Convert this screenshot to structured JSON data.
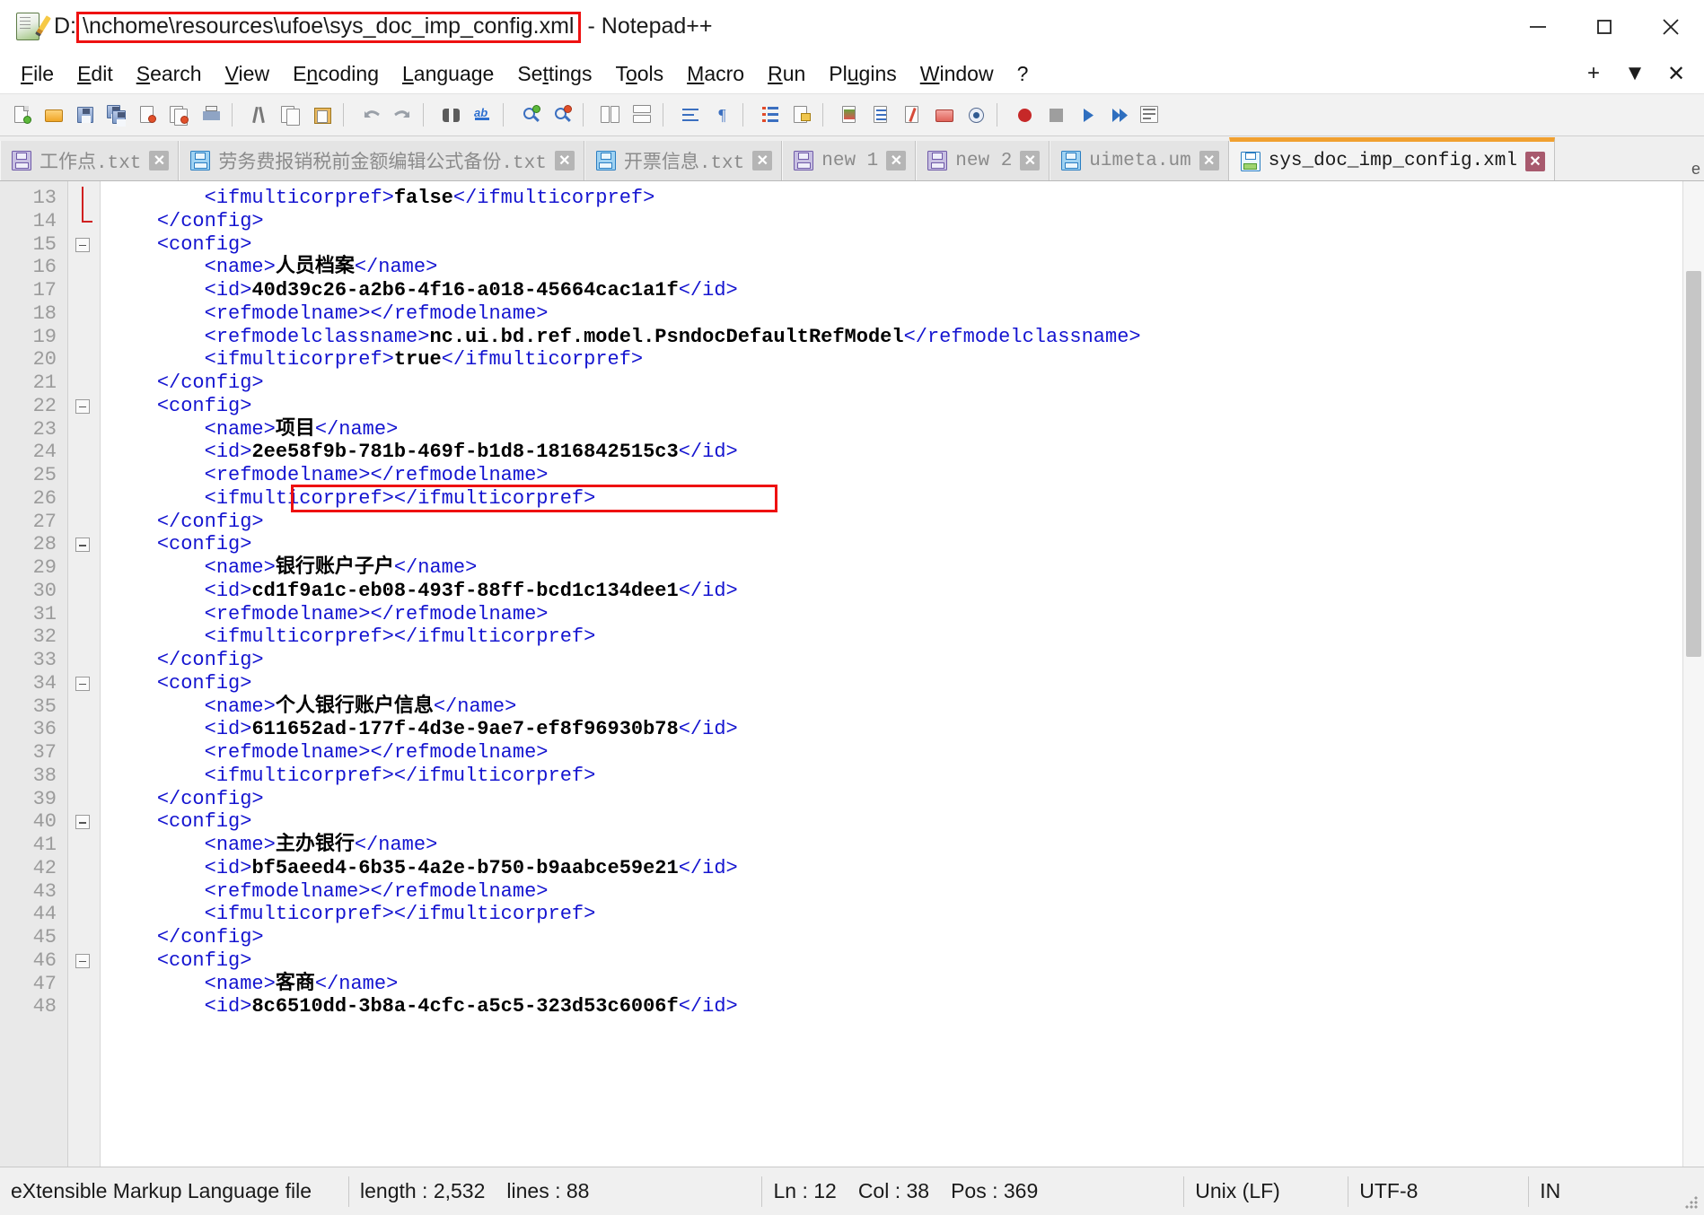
{
  "window": {
    "title_prefix": "D:",
    "title_path": "\\nchome\\resources\\ufoe\\sys_doc_imp_config.xml",
    "title_suffix": "- Notepad++",
    "icon": "notepad-plus-plus-icon",
    "minimize_label": "—",
    "maximize_label": "☐",
    "close_label": "✕",
    "accent_highlight": "#ee1111",
    "active_tab_accent": "#f0a030"
  },
  "menubar": {
    "items": [
      {
        "label": "File",
        "mnemonic": "F"
      },
      {
        "label": "Edit",
        "mnemonic": "E"
      },
      {
        "label": "Search",
        "mnemonic": "S"
      },
      {
        "label": "View",
        "mnemonic": "V"
      },
      {
        "label": "Encoding",
        "mnemonic": "n"
      },
      {
        "label": "Language",
        "mnemonic": "L"
      },
      {
        "label": "Settings",
        "mnemonic": "t"
      },
      {
        "label": "Tools",
        "mnemonic": "o"
      },
      {
        "label": "Macro",
        "mnemonic": "M"
      },
      {
        "label": "Run",
        "mnemonic": "R"
      },
      {
        "label": "Plugins",
        "mnemonic": "u"
      },
      {
        "label": "Window",
        "mnemonic": "W"
      },
      {
        "label": "?",
        "mnemonic": ""
      }
    ],
    "right_controls": [
      {
        "name": "new-tab-plus",
        "label": "+"
      },
      {
        "name": "tab-list-dropdown",
        "label": "▼"
      },
      {
        "name": "close-document",
        "label": "✕"
      }
    ]
  },
  "toolbar": {
    "buttons": [
      "new-file-icon",
      "open-file-icon",
      "save-icon",
      "save-all-icon",
      "close-file-icon",
      "close-all-icon",
      "print-icon",
      "cut-icon",
      "copy-icon",
      "paste-icon",
      "undo-icon",
      "redo-icon",
      "find-icon",
      "replace-icon",
      "zoom-in-icon",
      "zoom-out-icon",
      "sync-vertical-scroll-icon",
      "sync-horizontal-scroll-icon",
      "word-wrap-icon",
      "show-all-characters-icon",
      "indent-guide-icon",
      "user-defined-language-icon",
      "show-document-map-icon",
      "function-list-icon",
      "folder-as-workspace-icon",
      "monitoring-icon",
      "doc-switcher-icon",
      "start-record-macro-icon",
      "stop-record-macro-icon",
      "play-macro-icon",
      "run-macro-multiple-icon",
      "save-macro-icon"
    ]
  },
  "tabs": [
    {
      "label": "工作点.txt",
      "icon": "saved-file-icon",
      "icon_color": "purple",
      "active": false,
      "close_label": "✕"
    },
    {
      "label": "劳务费报销税前金额编辑公式备份.txt",
      "icon": "saved-file-icon",
      "icon_color": "blue",
      "active": false,
      "close_label": "✕"
    },
    {
      "label": "开票信息.txt",
      "icon": "saved-file-icon",
      "icon_color": "blue",
      "active": false,
      "close_label": "✕"
    },
    {
      "label": "new 1",
      "icon": "saved-file-icon",
      "icon_color": "purple",
      "active": false,
      "close_label": "✕"
    },
    {
      "label": "new 2",
      "icon": "saved-file-icon",
      "icon_color": "purple",
      "active": false,
      "close_label": "✕"
    },
    {
      "label": "uimeta.um",
      "icon": "saved-file-icon",
      "icon_color": "blue",
      "active": false,
      "close_label": "✕"
    },
    {
      "label": "sys_doc_imp_config.xml",
      "icon": "saved-file-icon",
      "icon_color": "green",
      "active": true,
      "close_label": "✕"
    }
  ],
  "editor": {
    "first_line_number": 13,
    "highlight_line_number": 26,
    "lines": [
      {
        "n": 13,
        "indent": 8,
        "fold": "none",
        "parts": [
          {
            "t": "tag",
            "s": "<ifmulticorpref>"
          },
          {
            "t": "val",
            "s": "false"
          },
          {
            "t": "tag",
            "s": "</ifmulticorpref>"
          }
        ]
      },
      {
        "n": 14,
        "indent": 4,
        "fold": "end",
        "parts": [
          {
            "t": "tag",
            "s": "</config>"
          }
        ]
      },
      {
        "n": 15,
        "indent": 4,
        "fold": "start",
        "parts": [
          {
            "t": "tag",
            "s": "<config>"
          }
        ]
      },
      {
        "n": 16,
        "indent": 8,
        "fold": "none",
        "parts": [
          {
            "t": "tag",
            "s": "<name>"
          },
          {
            "t": "val",
            "s": "人员档案"
          },
          {
            "t": "tag",
            "s": "</name>"
          }
        ]
      },
      {
        "n": 17,
        "indent": 8,
        "fold": "none",
        "parts": [
          {
            "t": "tag",
            "s": "<id>"
          },
          {
            "t": "val",
            "s": "40d39c26-a2b6-4f16-a018-45664cac1a1f"
          },
          {
            "t": "tag",
            "s": "</id>"
          }
        ]
      },
      {
        "n": 18,
        "indent": 8,
        "fold": "none",
        "parts": [
          {
            "t": "tag",
            "s": "<refmodelname></refmodelname>"
          }
        ]
      },
      {
        "n": 19,
        "indent": 8,
        "fold": "none",
        "parts": [
          {
            "t": "tag",
            "s": "<refmodelclassname>"
          },
          {
            "t": "val",
            "s": "nc.ui.bd.ref.model.PsndocDefaultRefModel"
          },
          {
            "t": "tag",
            "s": "</refmodelclassname>"
          }
        ]
      },
      {
        "n": 20,
        "indent": 8,
        "fold": "none",
        "parts": [
          {
            "t": "tag",
            "s": "<ifmulticorpref>"
          },
          {
            "t": "val",
            "s": "true"
          },
          {
            "t": "tag",
            "s": "</ifmulticorpref>"
          }
        ]
      },
      {
        "n": 21,
        "indent": 4,
        "fold": "end",
        "parts": [
          {
            "t": "tag",
            "s": "</config>"
          }
        ]
      },
      {
        "n": 22,
        "indent": 4,
        "fold": "start",
        "parts": [
          {
            "t": "tag",
            "s": "<config>"
          }
        ]
      },
      {
        "n": 23,
        "indent": 8,
        "fold": "none",
        "parts": [
          {
            "t": "tag",
            "s": "<name>"
          },
          {
            "t": "val",
            "s": "项目"
          },
          {
            "t": "tag",
            "s": "</name>"
          }
        ]
      },
      {
        "n": 24,
        "indent": 8,
        "fold": "none",
        "parts": [
          {
            "t": "tag",
            "s": "<id>"
          },
          {
            "t": "val",
            "s": "2ee58f9b-781b-469f-b1d8-1816842515c3"
          },
          {
            "t": "tag",
            "s": "</id>"
          }
        ]
      },
      {
        "n": 25,
        "indent": 8,
        "fold": "none",
        "parts": [
          {
            "t": "tag",
            "s": "<refmodelname></refmodelname>"
          }
        ]
      },
      {
        "n": 26,
        "indent": 8,
        "fold": "none",
        "parts": [
          {
            "t": "tag",
            "s": "<ifmulticorpref></ifmulticorpref>"
          }
        ]
      },
      {
        "n": 27,
        "indent": 4,
        "fold": "end",
        "parts": [
          {
            "t": "tag",
            "s": "</config>"
          }
        ]
      },
      {
        "n": 28,
        "indent": 4,
        "fold": "start",
        "parts": [
          {
            "t": "tag",
            "s": "<config>"
          }
        ]
      },
      {
        "n": 29,
        "indent": 8,
        "fold": "none",
        "parts": [
          {
            "t": "tag",
            "s": "<name>"
          },
          {
            "t": "val",
            "s": "银行账户子户"
          },
          {
            "t": "tag",
            "s": "</name>"
          }
        ]
      },
      {
        "n": 30,
        "indent": 8,
        "fold": "none",
        "parts": [
          {
            "t": "tag",
            "s": "<id>"
          },
          {
            "t": "val",
            "s": "cd1f9a1c-eb08-493f-88ff-bcd1c134dee1"
          },
          {
            "t": "tag",
            "s": "</id>"
          }
        ]
      },
      {
        "n": 31,
        "indent": 8,
        "fold": "none",
        "parts": [
          {
            "t": "tag",
            "s": "<refmodelname></refmodelname>"
          }
        ]
      },
      {
        "n": 32,
        "indent": 8,
        "fold": "none",
        "parts": [
          {
            "t": "tag",
            "s": "<ifmulticorpref></ifmulticorpref>"
          }
        ]
      },
      {
        "n": 33,
        "indent": 4,
        "fold": "end",
        "parts": [
          {
            "t": "tag",
            "s": "</config>"
          }
        ]
      },
      {
        "n": 34,
        "indent": 4,
        "fold": "start",
        "parts": [
          {
            "t": "tag",
            "s": "<config>"
          }
        ]
      },
      {
        "n": 35,
        "indent": 8,
        "fold": "none",
        "parts": [
          {
            "t": "tag",
            "s": "<name>"
          },
          {
            "t": "val",
            "s": "个人银行账户信息"
          },
          {
            "t": "tag",
            "s": "</name>"
          }
        ]
      },
      {
        "n": 36,
        "indent": 8,
        "fold": "none",
        "parts": [
          {
            "t": "tag",
            "s": "<id>"
          },
          {
            "t": "val",
            "s": "611652ad-177f-4d3e-9ae7-ef8f96930b78"
          },
          {
            "t": "tag",
            "s": "</id>"
          }
        ]
      },
      {
        "n": 37,
        "indent": 8,
        "fold": "none",
        "parts": [
          {
            "t": "tag",
            "s": "<refmodelname></refmodelname>"
          }
        ]
      },
      {
        "n": 38,
        "indent": 8,
        "fold": "none",
        "parts": [
          {
            "t": "tag",
            "s": "<ifmulticorpref></ifmulticorpref>"
          }
        ]
      },
      {
        "n": 39,
        "indent": 4,
        "fold": "end",
        "parts": [
          {
            "t": "tag",
            "s": "</config>"
          }
        ]
      },
      {
        "n": 40,
        "indent": 4,
        "fold": "start",
        "parts": [
          {
            "t": "tag",
            "s": "<config>"
          }
        ]
      },
      {
        "n": 41,
        "indent": 8,
        "fold": "none",
        "parts": [
          {
            "t": "tag",
            "s": "<name>"
          },
          {
            "t": "val",
            "s": "主办银行"
          },
          {
            "t": "tag",
            "s": "</name>"
          }
        ]
      },
      {
        "n": 42,
        "indent": 8,
        "fold": "none",
        "parts": [
          {
            "t": "tag",
            "s": "<id>"
          },
          {
            "t": "val",
            "s": "bf5aeed4-6b35-4a2e-b750-b9aabce59e21"
          },
          {
            "t": "tag",
            "s": "</id>"
          }
        ]
      },
      {
        "n": 43,
        "indent": 8,
        "fold": "none",
        "parts": [
          {
            "t": "tag",
            "s": "<refmodelname></refmodelname>"
          }
        ]
      },
      {
        "n": 44,
        "indent": 8,
        "fold": "none",
        "parts": [
          {
            "t": "tag",
            "s": "<ifmulticorpref></ifmulticorpref>"
          }
        ]
      },
      {
        "n": 45,
        "indent": 4,
        "fold": "end",
        "parts": [
          {
            "t": "tag",
            "s": "</config>"
          }
        ]
      },
      {
        "n": 46,
        "indent": 4,
        "fold": "start",
        "parts": [
          {
            "t": "tag",
            "s": "<config>"
          }
        ]
      },
      {
        "n": 47,
        "indent": 8,
        "fold": "none",
        "parts": [
          {
            "t": "tag",
            "s": "<name>"
          },
          {
            "t": "val",
            "s": "客商"
          },
          {
            "t": "tag",
            "s": "</name>"
          }
        ]
      },
      {
        "n": 48,
        "indent": 8,
        "fold": "none",
        "parts": [
          {
            "t": "tag",
            "s": "<id>"
          },
          {
            "t": "val",
            "s": "8c6510dd-3b8a-4cfc-a5c5-323d53c6006f"
          },
          {
            "t": "tag",
            "s": "</id>"
          }
        ]
      }
    ]
  },
  "statusbar": {
    "language": "eXtensible Markup Language file",
    "length_label": "length : 2,532",
    "lines_label": "lines : 88",
    "ln": "Ln : 12",
    "col": "Col : 38",
    "pos": "Pos : 369",
    "eol": "Unix (LF)",
    "encoding": "UTF-8",
    "insert_mode": "IN"
  }
}
